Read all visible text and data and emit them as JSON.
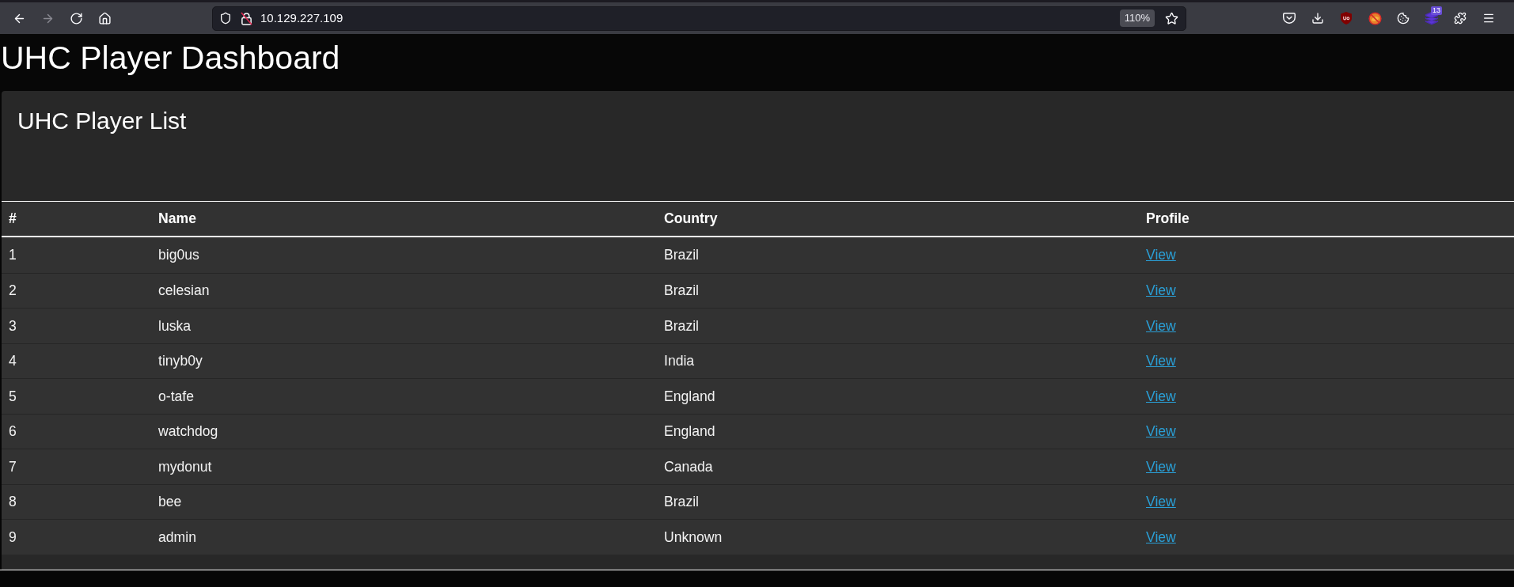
{
  "browser": {
    "nav_buttons": [
      {
        "kind": "back",
        "disabled": false
      },
      {
        "kind": "forward",
        "disabled": true
      },
      {
        "kind": "reload",
        "disabled": false
      },
      {
        "kind": "home",
        "disabled": false
      }
    ],
    "address_bar": {
      "url": "10.129.227.109",
      "zoom": "110%"
    },
    "toolbar_items": [
      {
        "kind": "pocket"
      },
      {
        "kind": "download"
      },
      {
        "kind": "shield"
      },
      {
        "kind": "prohibited"
      },
      {
        "kind": "cookie"
      },
      {
        "kind": "layers",
        "badge": "13"
      },
      {
        "kind": "extensions"
      },
      {
        "kind": "menu"
      }
    ]
  },
  "header": {
    "title": "UHC Player Dashboard"
  },
  "player_list": {
    "title": "UHC Player List",
    "table": {
      "columns": [
        "#",
        "Name",
        "Country",
        "Profile"
      ],
      "rows": [
        {
          "number": "1",
          "name": "big0us",
          "country": "Brazil",
          "profile": "View"
        },
        {
          "number": "2",
          "name": "celesian",
          "country": "Brazil",
          "profile": "View"
        },
        {
          "number": "3",
          "name": "luska",
          "country": "Brazil",
          "profile": "View"
        },
        {
          "number": "4",
          "name": "tinyb0y",
          "country": "India",
          "profile": "View"
        },
        {
          "number": "5",
          "name": "o-tafe",
          "country": "England",
          "profile": "View"
        },
        {
          "number": "6",
          "name": "watchdog",
          "country": "England",
          "profile": "View"
        },
        {
          "number": "7",
          "name": "mydonut",
          "country": "Canada",
          "profile": "View"
        },
        {
          "number": "8",
          "name": "bee",
          "country": "Brazil",
          "profile": "View"
        },
        {
          "number": "9",
          "name": "admin",
          "country": "Unknown",
          "profile": "View"
        }
      ]
    }
  }
}
